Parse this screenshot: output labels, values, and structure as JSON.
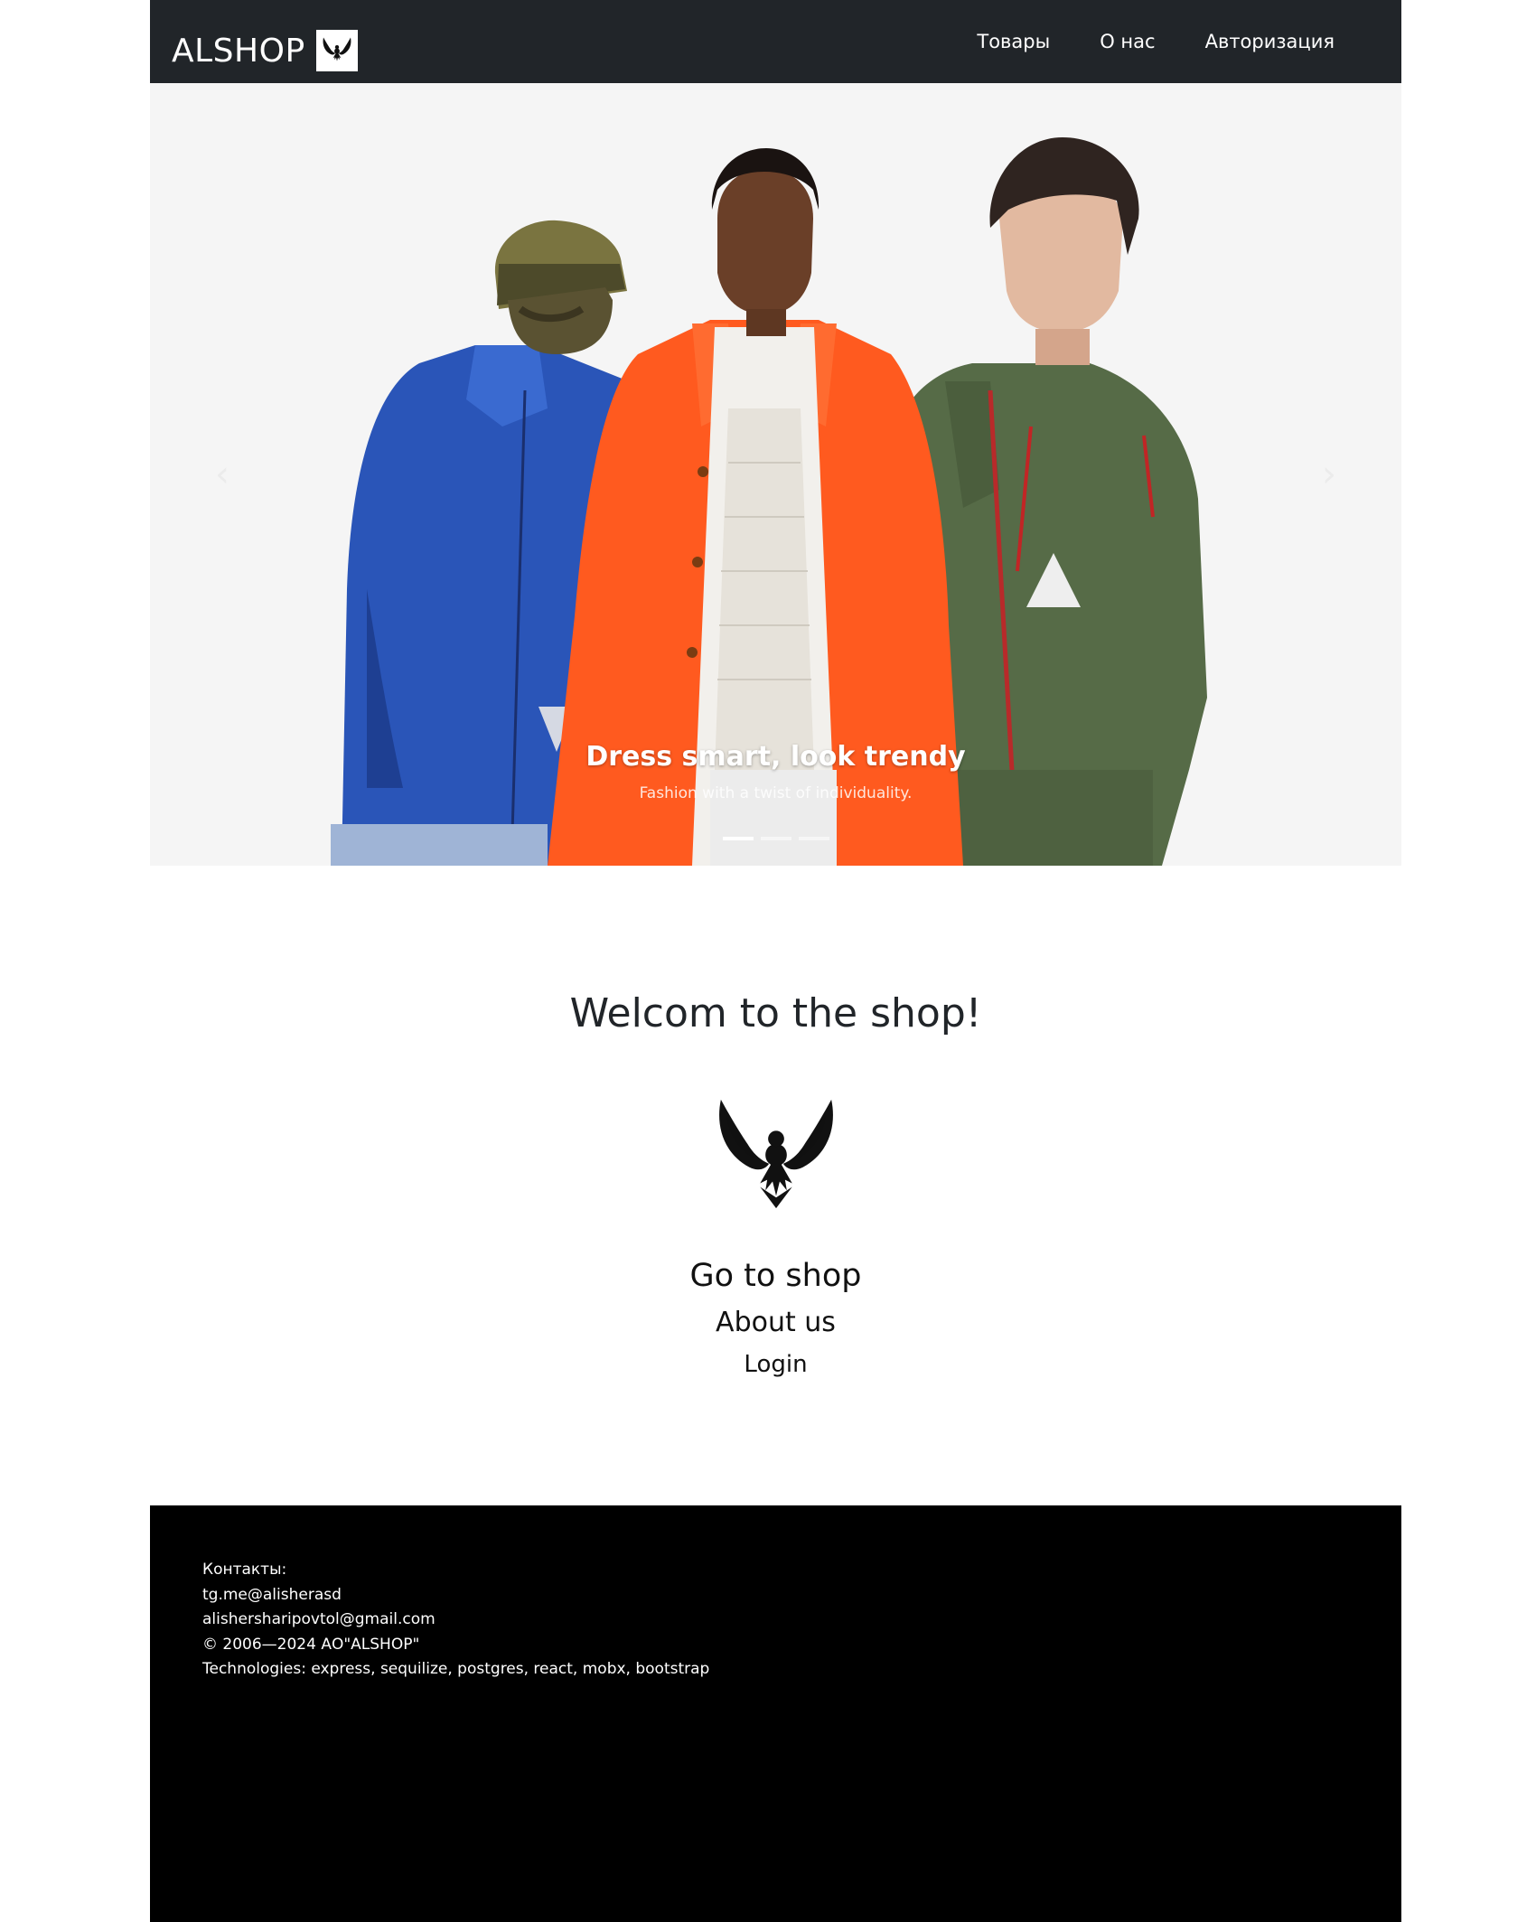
{
  "navbar": {
    "brand": "ALSHOP",
    "links": [
      "Товары",
      "О нас",
      "Авторизация"
    ],
    "background": "#212529",
    "logo_icon": "eagle-icon"
  },
  "carousel": {
    "title": "Dress smart, look trendy",
    "text": "Fashion with a twist of individuality.",
    "slides_count": 3,
    "active_slide": 1,
    "prev_icon": "chevron-left-icon",
    "next_icon": "chevron-right-icon"
  },
  "welcome": {
    "title": "Welcom to the shop!",
    "logo_icon": "eagle-icon",
    "links": [
      "Go to shop",
      "About us",
      "Login"
    ]
  },
  "footer": {
    "background": "#000000",
    "contacts_label": "Контакты:",
    "telegram": "tg.me@alisherasd",
    "email": "alishersharipovtol@gmail.com",
    "copyright": "© 2006—2024 АО\"ALSHOP\"",
    "technologies": "Technologies: express, sequilize, postgres, react, mobx, bootstrap"
  }
}
